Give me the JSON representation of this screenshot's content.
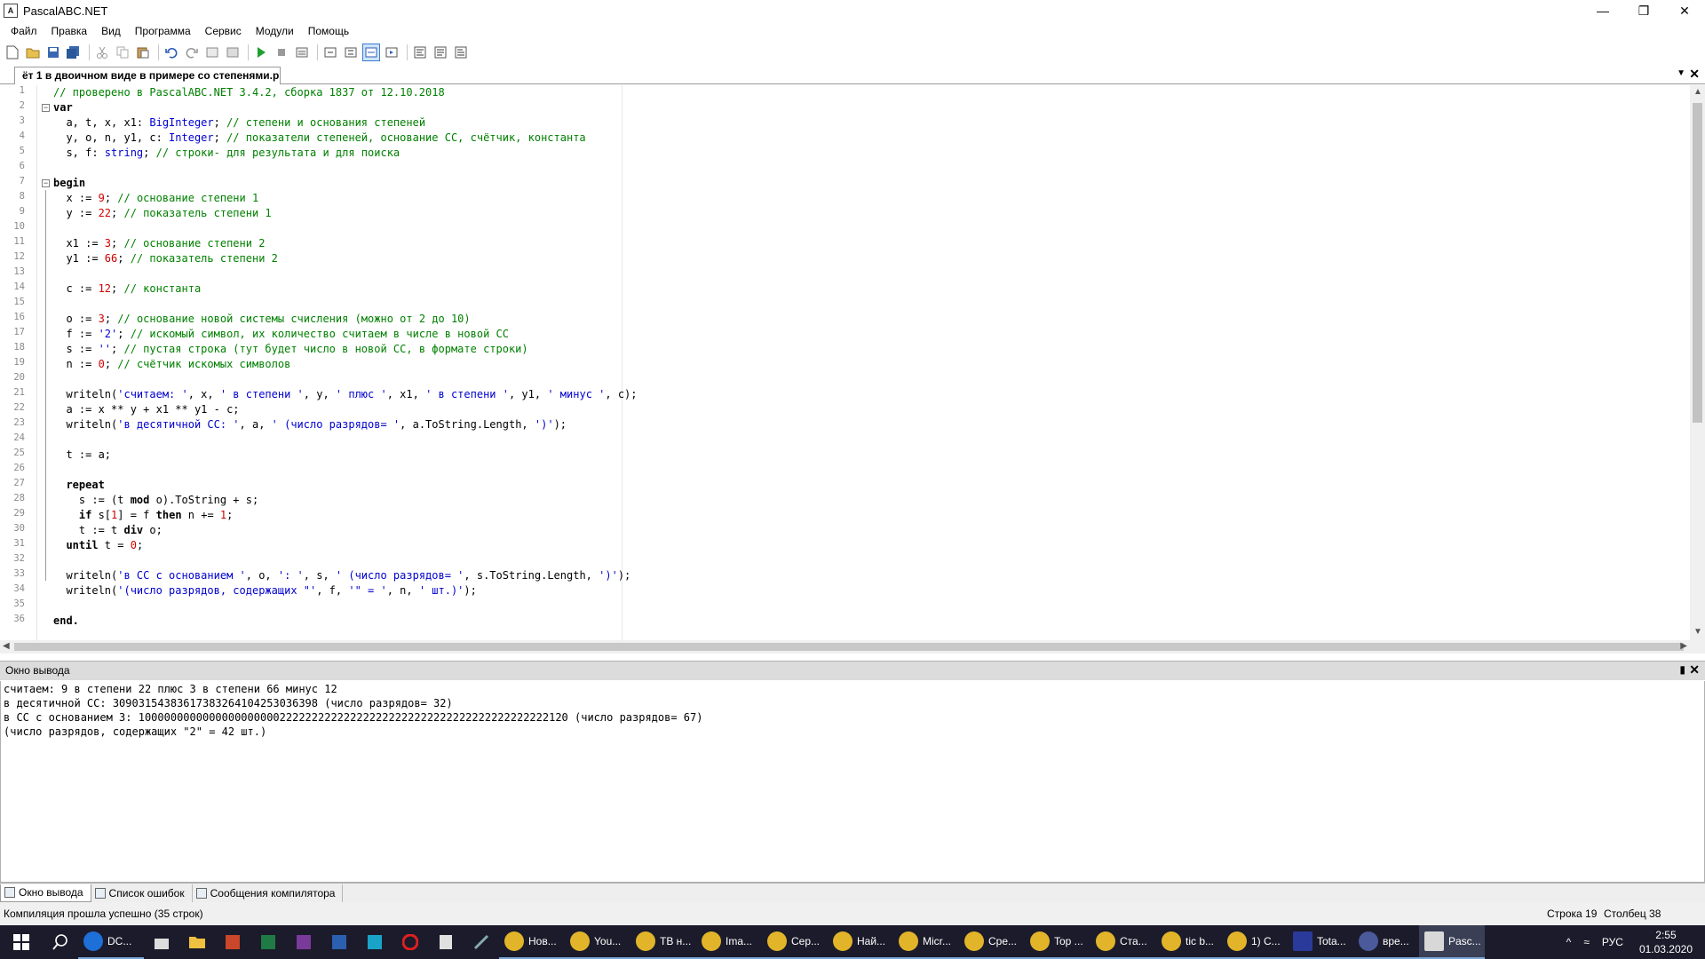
{
  "window": {
    "title": "PascalABC.NET"
  },
  "menu": [
    "Файл",
    "Правка",
    "Вид",
    "Программа",
    "Сервис",
    "Модули",
    "Помощь"
  ],
  "doc_tab": {
    "label": "ёт 1 в двоичном виде в примере со степенями.p"
  },
  "editor": {
    "lines": [
      "1",
      "2",
      "3",
      "4",
      "5",
      "6",
      "7",
      "8",
      "9",
      "10",
      "11",
      "12",
      "13",
      "14",
      "15",
      "16",
      "17",
      "18",
      "19",
      "20",
      "21",
      "22",
      "23",
      "24",
      "25",
      "26",
      "27",
      "28",
      "29",
      "30",
      "31",
      "32",
      "33",
      "34",
      "35",
      "36"
    ]
  },
  "output": {
    "title": "Окно вывода",
    "lines": [
      "считаем: 9 в степени 22 плюс 3 в степени 66 минус 12",
      "в десятичной СС: 30903154383617383264104253036398 (число разрядов= 32)",
      "в СС с основанием 3: 1000000000000000000000222222222222222222222222222222222222222222120 (число разрядов= 67)",
      "(число разрядов, содержащих \"2\" = 42 шт.)"
    ]
  },
  "bottom_tabs": [
    "Окно вывода",
    "Список ошибок",
    "Сообщения компилятора"
  ],
  "status": {
    "message": "Компиляция прошла успешно (35 строк)",
    "line": "Строка  19",
    "col": "Столбец  38"
  },
  "taskbar": {
    "apps": [
      "DC...",
      "Нов...",
      "You...",
      "ТВ н...",
      "Ima...",
      "Сер...",
      "Най...",
      "Micr...",
      "Сре...",
      "Top ...",
      "Ста...",
      "tic b...",
      "1) С...",
      "Tota...",
      "вре...",
      "Pasc..."
    ],
    "lang": "РУС",
    "time": "2:55",
    "date": "01.03.2020"
  }
}
